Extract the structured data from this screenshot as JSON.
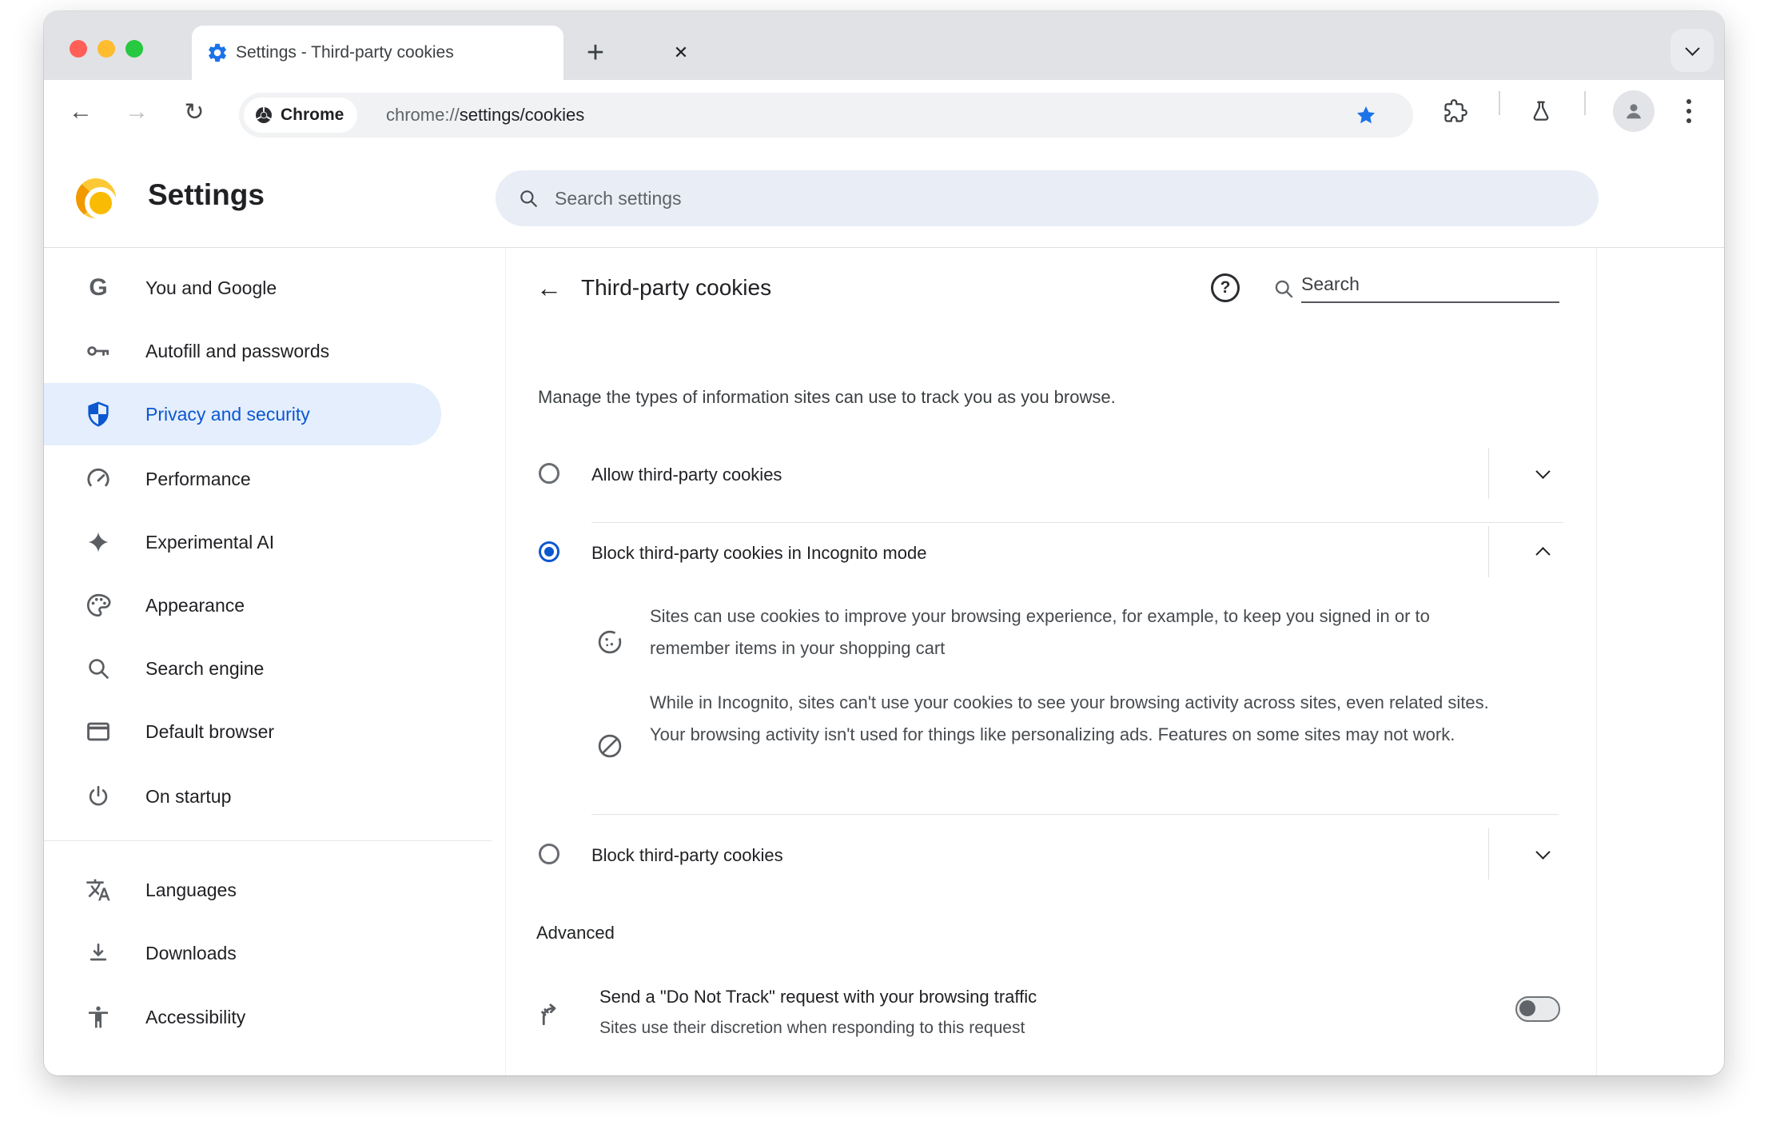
{
  "window": {
    "buttons": [
      "close",
      "minimize",
      "zoom"
    ]
  },
  "tab": {
    "title": "Settings - Third-party cookies",
    "close_glyph": "✕",
    "new_tab_glyph": "+"
  },
  "toolbar": {
    "back_glyph": "←",
    "forward_glyph": "→",
    "reload_glyph": "↻",
    "chip_label": "Chrome",
    "url_scheme": "chrome://",
    "url_path": "settings/cookies"
  },
  "header": {
    "title": "Settings",
    "search_placeholder": "Search settings"
  },
  "sidebar": {
    "items": [
      {
        "label": "You and Google",
        "icon": "google-g-icon",
        "selected": false
      },
      {
        "label": "Autofill and passwords",
        "icon": "key-icon",
        "selected": false
      },
      {
        "label": "Privacy and security",
        "icon": "shield-icon",
        "selected": true
      },
      {
        "label": "Performance",
        "icon": "speedometer-icon",
        "selected": false
      },
      {
        "label": "Experimental AI",
        "icon": "sparkle-icon",
        "selected": false
      },
      {
        "label": "Appearance",
        "icon": "palette-icon",
        "selected": false
      },
      {
        "label": "Search engine",
        "icon": "magnifier-icon",
        "selected": false
      },
      {
        "label": "Default browser",
        "icon": "browser-window-icon",
        "selected": false
      },
      {
        "label": "On startup",
        "icon": "power-icon",
        "selected": false
      },
      {
        "label": "Languages",
        "icon": "translate-icon",
        "selected": false
      },
      {
        "label": "Downloads",
        "icon": "download-icon",
        "selected": false
      },
      {
        "label": "Accessibility",
        "icon": "accessibility-icon",
        "selected": false
      }
    ]
  },
  "content": {
    "page_title": "Third-party cookies",
    "help_glyph": "?",
    "search_placeholder": "Search",
    "intro": "Manage the types of information sites can use to track you as you browse.",
    "options": [
      {
        "label": "Allow third-party cookies",
        "state": "collapsed",
        "selected": false
      },
      {
        "label": "Block third-party cookies in Incognito mode",
        "state": "expanded",
        "selected": true,
        "details": [
          {
            "icon": "cookie-icon",
            "text": "Sites can use cookies to improve your browsing experience, for example, to keep you signed in or to remember items in your shopping cart"
          },
          {
            "icon": "blocked-icon",
            "text": "While in Incognito, sites can't use your cookies to see your browsing activity across sites, even related sites. Your browsing activity isn't used for things like personalizing ads. Features on some sites may not work."
          }
        ]
      },
      {
        "label": "Block third-party cookies",
        "state": "collapsed",
        "selected": false
      }
    ],
    "advanced_label": "Advanced",
    "dnt": {
      "title": "Send a \"Do Not Track\" request with your browsing traffic",
      "subtitle": "Sites use their discretion when responding to this request",
      "toggle_state": "off"
    }
  },
  "colors": {
    "accent_blue": "#0B57D0",
    "favicon_blue": "#1A73E8",
    "selected_item_bg": "#E4EEFC",
    "canary_yellow": "#FDC835",
    "traffic_red": "#FF5F57",
    "traffic_yellow": "#FEBC2E",
    "traffic_green": "#28C840"
  }
}
